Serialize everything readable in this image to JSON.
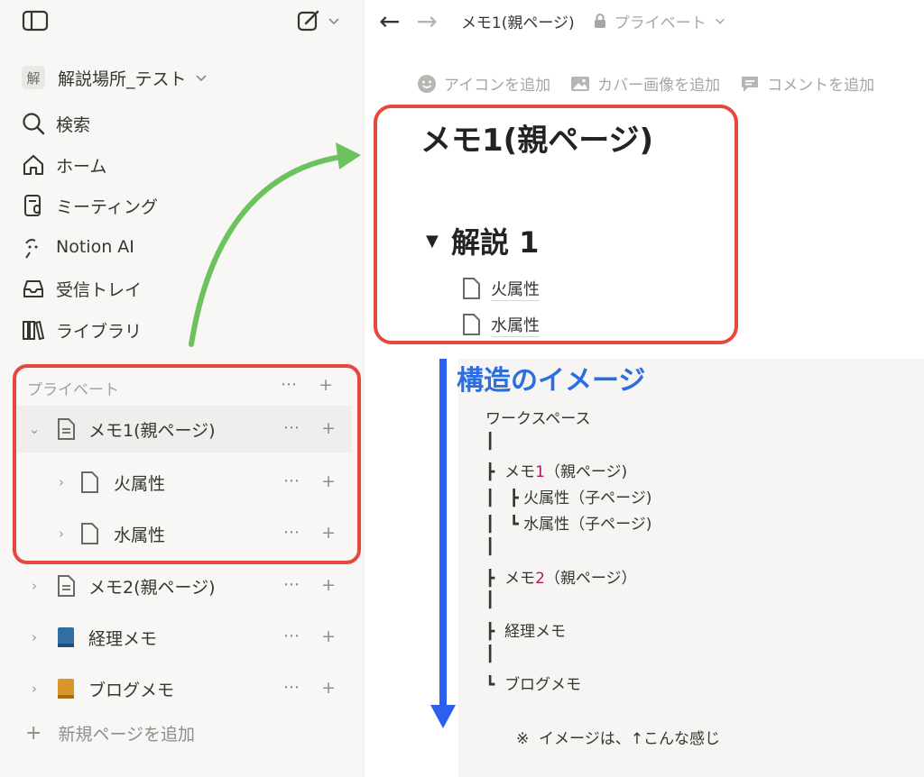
{
  "sidebar": {
    "workspace": {
      "badge": "解",
      "name": "解説場所_テスト"
    },
    "nav": [
      {
        "label": "検索",
        "icon": "search-icon"
      },
      {
        "label": "ホーム",
        "icon": "home-icon"
      },
      {
        "label": "ミーティング",
        "icon": "meeting-icon"
      },
      {
        "label": "Notion AI",
        "icon": "notion-ai-icon"
      },
      {
        "label": "受信トレイ",
        "icon": "inbox-icon"
      },
      {
        "label": "ライブラリ",
        "icon": "library-icon"
      }
    ],
    "private_title": "プライベート",
    "private_pages": [
      {
        "title": "メモ1(親ページ)"
      },
      {
        "title": "火属性"
      },
      {
        "title": "水属性"
      }
    ],
    "other_pages": [
      {
        "title": "メモ2(親ページ)",
        "icon": "page-icon"
      },
      {
        "title": "経理メモ",
        "icon": "blue-book-icon",
        "color": "#2f6fa3"
      },
      {
        "title": "ブログメモ",
        "icon": "orange-book-icon",
        "color": "#d9962b"
      }
    ],
    "add_page_label": "新規ページを追加",
    "more": "···",
    "plus": "+"
  },
  "topbar": {
    "breadcrumb": "メモ1(親ページ)",
    "privacy": "プライベート"
  },
  "page_actions": {
    "add_icon": "アイコンを追加",
    "add_cover": "カバー画像を追加",
    "add_comment": "コメントを追加"
  },
  "page": {
    "title": "メモ1(親ページ)",
    "toggle_heading": "解説 1",
    "sub_pages": [
      "火属性",
      "水属性"
    ]
  },
  "structure": {
    "title": "構造のイメージ",
    "root": "ワークスペース",
    "memo1_pre": "メモ",
    "memo1_num": "1",
    "memo1_post": "（親ページ)",
    "child1": "火属性（子ページ)",
    "child2": "水属性（子ページ)",
    "memo2_pre": "メモ",
    "memo2_num": "2",
    "memo2_post": "（親ページ）",
    "keiri": "経理メモ",
    "blog": "ブログメモ",
    "note": "※  イメージは、↑こんな感じ"
  },
  "colors": {
    "accent_red": "#e5483e",
    "arrow_green": "#6cc35e",
    "arrow_blue": "#2a5ff0",
    "title_blue": "#2a6ee0"
  }
}
